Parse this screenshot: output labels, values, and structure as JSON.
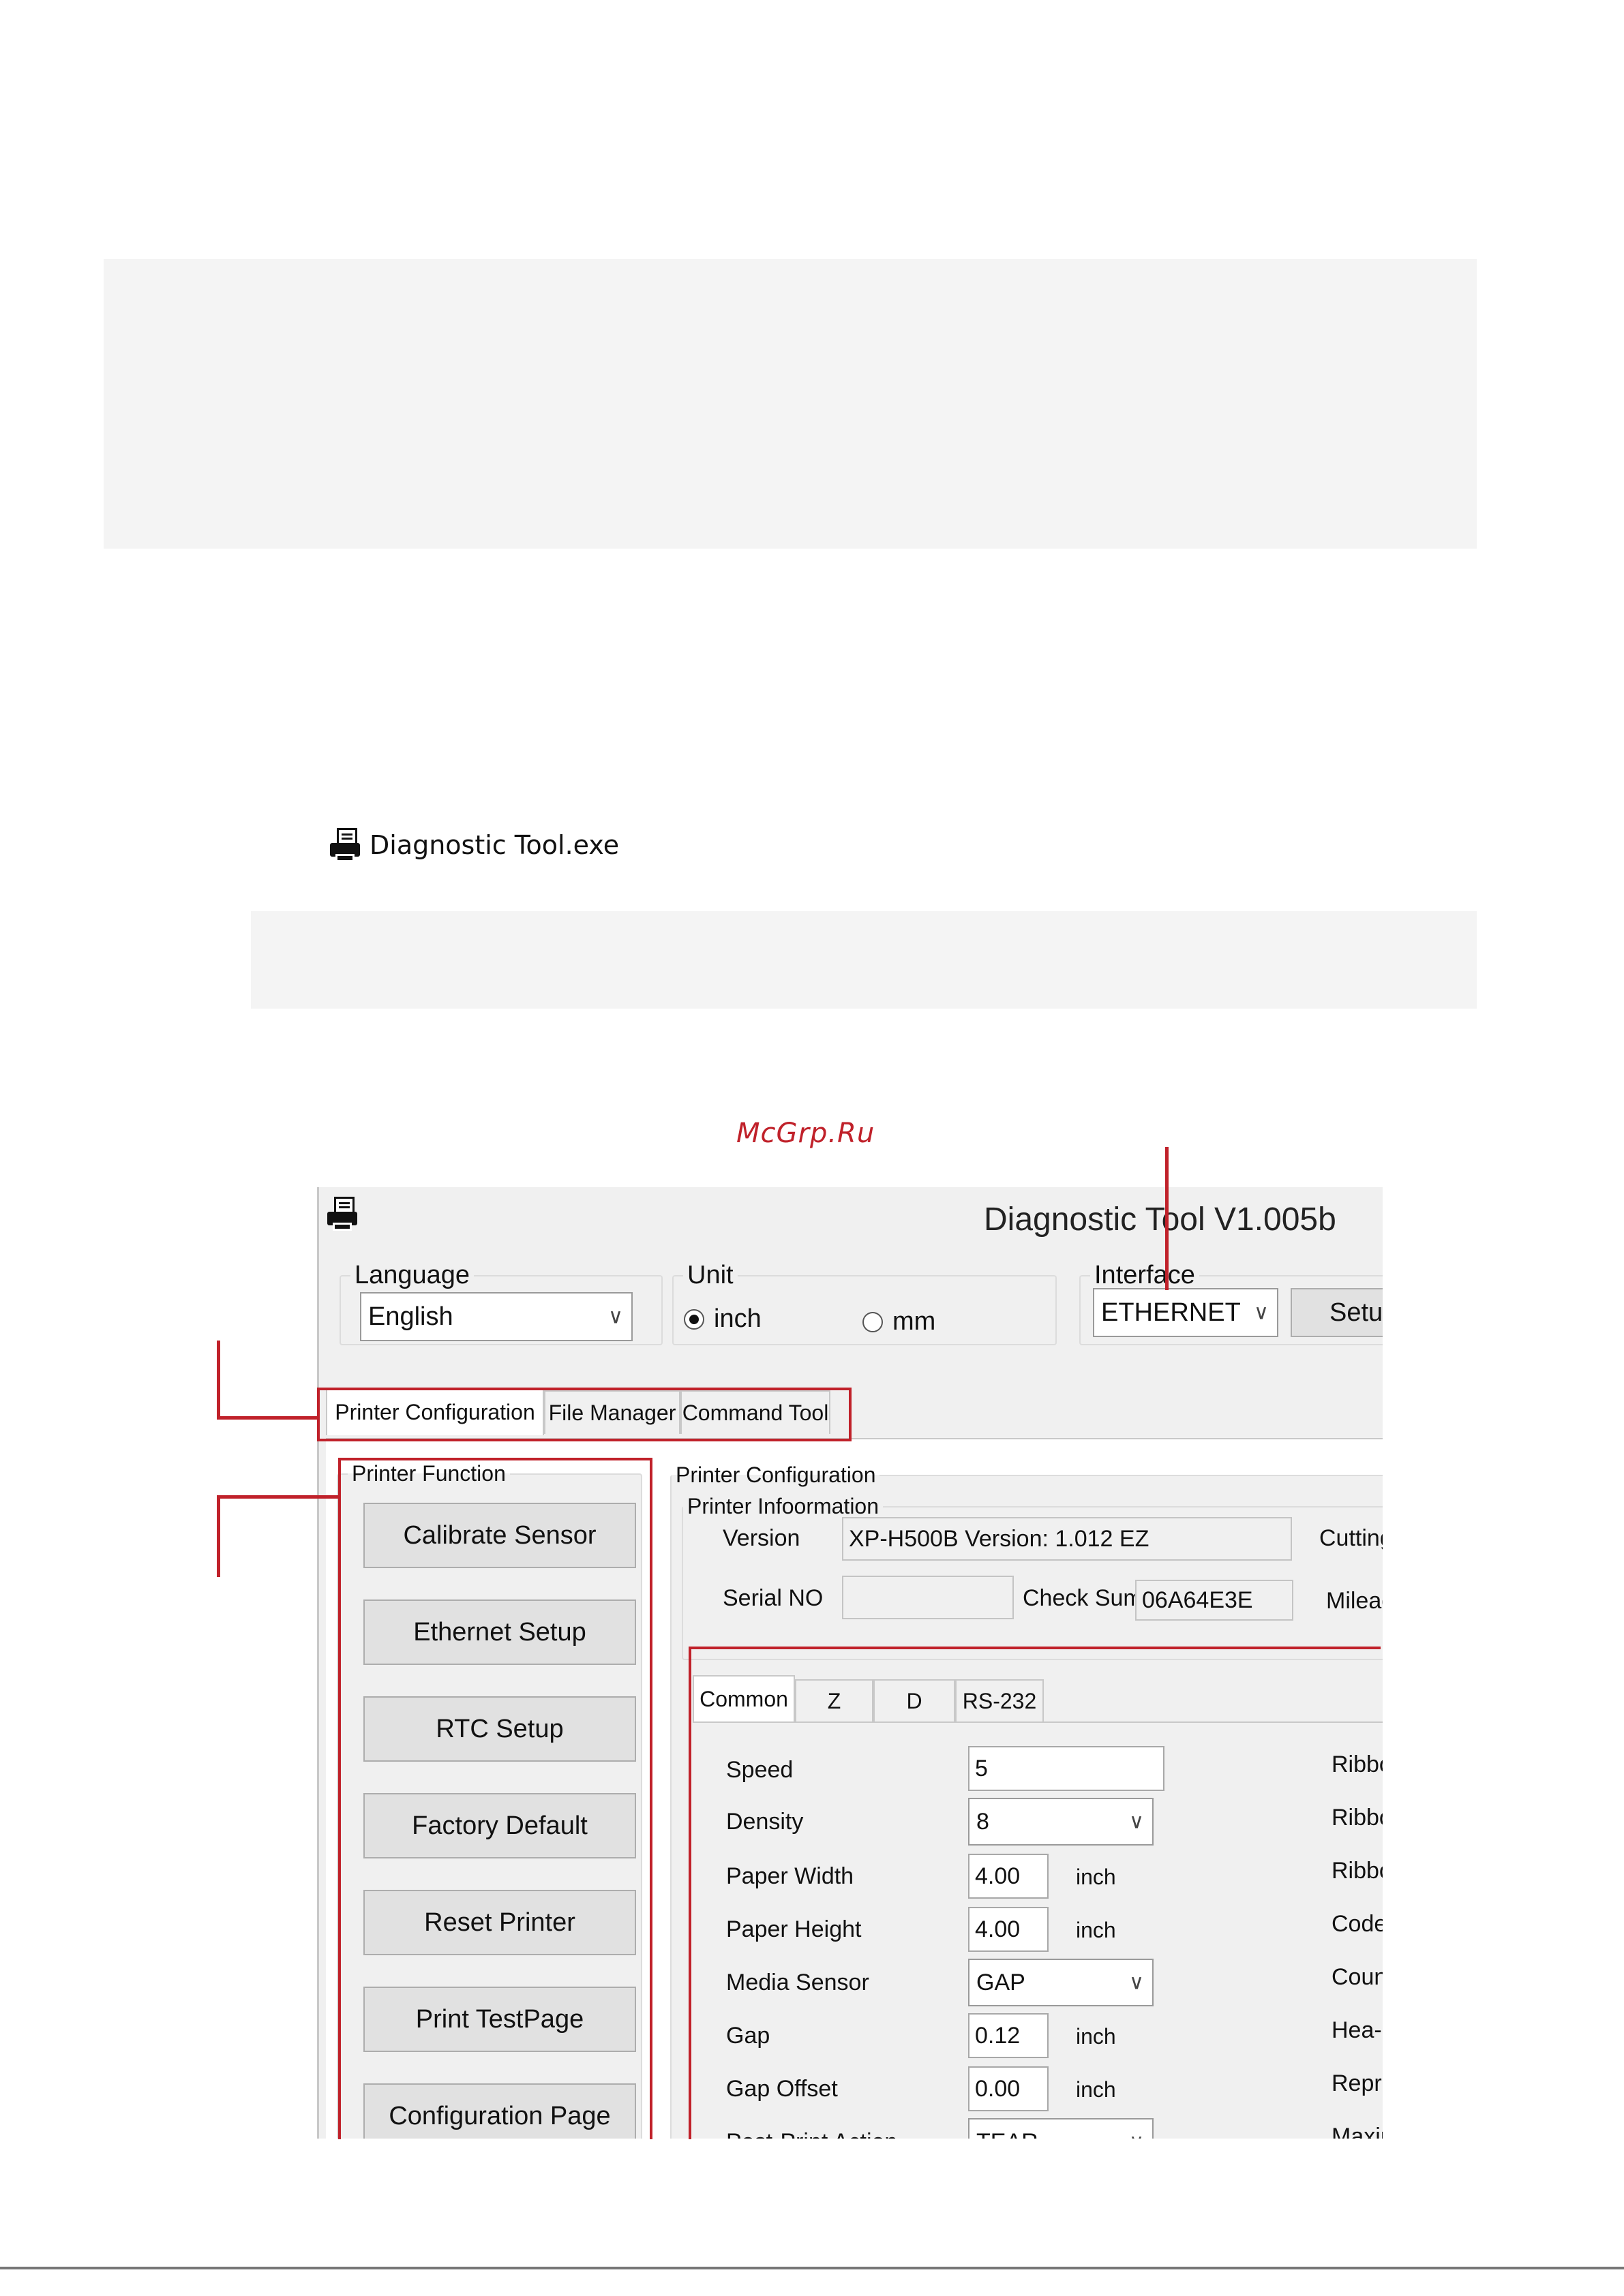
{
  "file_entry": {
    "icon": "printer-icon",
    "label": "Diagnostic Tool.exe"
  },
  "watermark": "McGrp.Ru",
  "app": {
    "title": "Diagnostic Tool V1.005b",
    "title_icon": "printer-icon",
    "language": {
      "label": "Language",
      "value": "English"
    },
    "unit": {
      "label": "Unit",
      "options": [
        "inch",
        "mm"
      ],
      "selected": "inch"
    },
    "interface": {
      "label": "Interface",
      "value": "ETHERNET",
      "setup_button": "Setu"
    },
    "main_tabs": [
      "Printer Configuration",
      "File Manager",
      "Command Tool"
    ],
    "active_main_tab": "Printer Configuration",
    "printer_function": {
      "label": "Printer  Function",
      "buttons": [
        "Calibrate Sensor",
        "Ethernet Setup",
        "RTC Setup",
        "Factory Default",
        "Reset Printer",
        "Print TestPage",
        "Configuration Page"
      ]
    },
    "printer_configuration": {
      "label": "Printer Configuration",
      "info_label": "Printer Infoormation",
      "version_label": "Version",
      "version_value": "XP-H500B Version: 1.012 EZ",
      "serial_label": "Serial NO",
      "serial_value": "",
      "checksum_label": "Check Sum",
      "checksum_value": "06A64E3E",
      "right_label_1": "Cutting",
      "right_label_2": "Mileag"
    },
    "sub_tabs": [
      "Common",
      "Z",
      "D",
      "RS-232"
    ],
    "active_sub_tab": "Common",
    "common": {
      "speed": {
        "label": "Speed",
        "value": "5"
      },
      "density": {
        "label": "Density",
        "value": "8"
      },
      "paper_width": {
        "label": "Paper Width",
        "value": "4.00",
        "unit": "inch"
      },
      "paper_height": {
        "label": "Paper Height",
        "value": "4.00",
        "unit": "inch"
      },
      "media_sensor": {
        "label": "Media Sensor",
        "value": "GAP"
      },
      "gap": {
        "label": "Gap",
        "value": "0.12",
        "unit": "inch"
      },
      "gap_offset": {
        "label": "Gap Offset",
        "value": "0.00",
        "unit": "inch"
      },
      "post_print": {
        "label": "Post-Print  Action",
        "value": "TEAR"
      },
      "right_labels": [
        "Ribbo",
        "Ribbo",
        "Ribbo",
        "Code",
        "Coun",
        "Hea-u",
        "Repri",
        "Maxir"
      ]
    }
  },
  "colors": {
    "highlight": "#c0212a",
    "window_bg": "#f0f0f0"
  }
}
